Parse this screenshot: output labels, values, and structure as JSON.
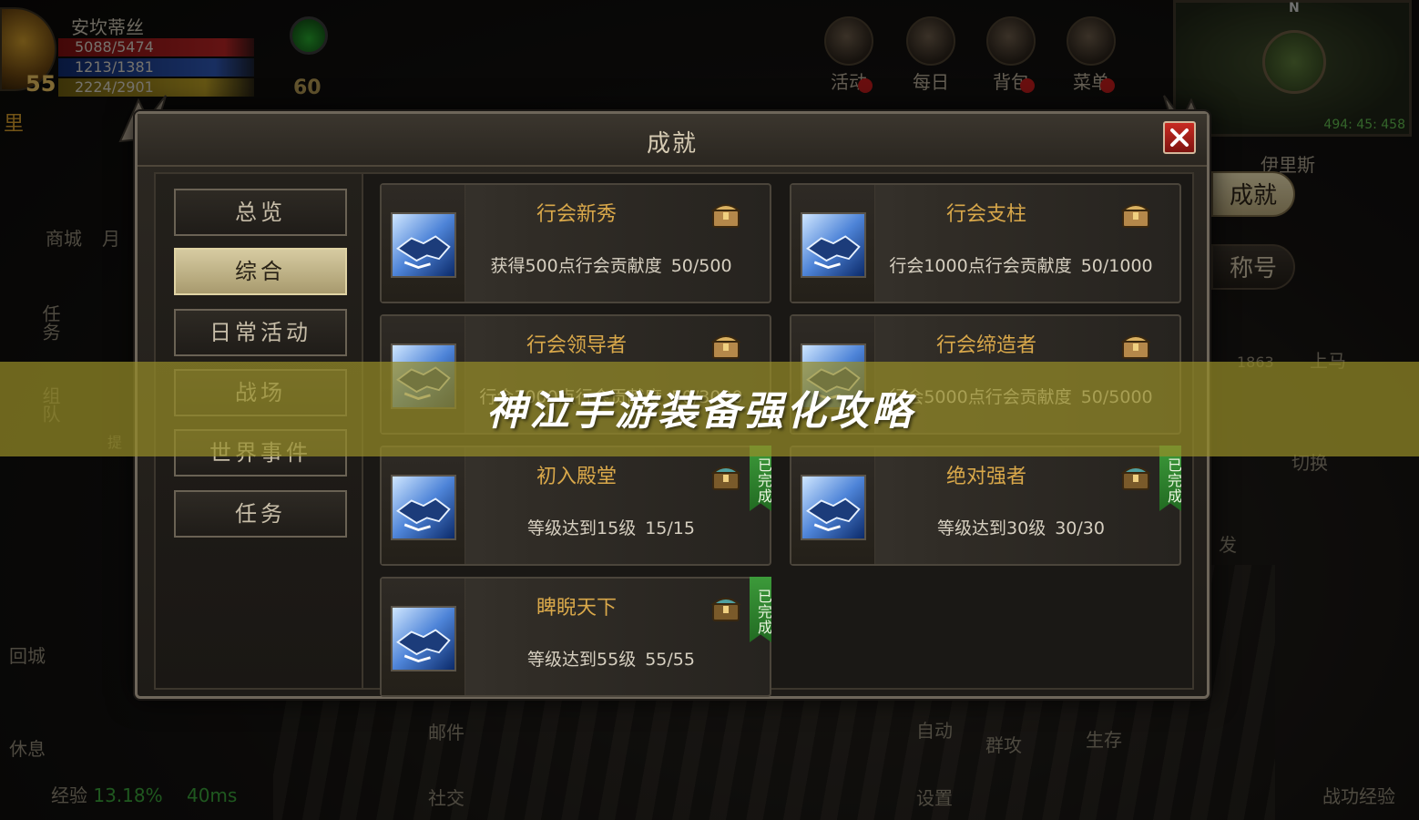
{
  "hud": {
    "player_name": "安坎蒂丝",
    "level": "55",
    "hp": "5088/5474",
    "mp": "1213/1381",
    "xp": "2224/2901",
    "power": "60",
    "map_label": "里",
    "top_icons": [
      {
        "label": "活动",
        "icon": "activity-icon"
      },
      {
        "label": "每日",
        "icon": "daily-icon"
      },
      {
        "label": "背包",
        "icon": "bag-icon"
      },
      {
        "label": "菜单",
        "icon": "menu-icon"
      }
    ],
    "minimap_north": "N",
    "coords": "494: 45: 458",
    "zone_name": "伊里斯",
    "side_tabs": {
      "active": "成就",
      "idle": "称号"
    },
    "left_buttons": [
      "商城",
      "月",
      "任务",
      "组队",
      "回城",
      "休息"
    ],
    "other_labels": [
      "上马",
      "切换",
      "邮件",
      "社交",
      "自动",
      "群攻",
      "生存",
      "设置",
      "战功经验",
      "发",
      "1863",
      "提"
    ],
    "exp_label": "经验",
    "exp_pct": "13.18%",
    "ping": "40ms"
  },
  "panel": {
    "title": "成就",
    "categories": [
      "总览",
      "综合",
      "日常活动",
      "战场",
      "世界事件",
      "任务"
    ],
    "active_category_index": 1,
    "cards": [
      {
        "title": "行会新秀",
        "desc": "获得500点行会贡献度",
        "progress": "50/500",
        "completed": false
      },
      {
        "title": "行会支柱",
        "desc": "行会1000点行会贡献度",
        "progress": "50/1000",
        "completed": false
      },
      {
        "title": "行会领导者",
        "desc": "行会3000点行会贡献度",
        "progress": "50/3000",
        "completed": false
      },
      {
        "title": "行会缔造者",
        "desc": "行会5000点行会贡献度",
        "progress": "50/5000",
        "completed": false
      },
      {
        "title": "初入殿堂",
        "desc": "等级达到15级",
        "progress": "15/15",
        "completed": true
      },
      {
        "title": "绝对强者",
        "desc": "等级达到30级",
        "progress": "30/30",
        "completed": true
      },
      {
        "title": "睥睨天下",
        "desc": "等级达到55级",
        "progress": "55/55",
        "completed": true
      }
    ],
    "done_label": "已完成"
  },
  "banner": {
    "text": "神泣手游装备强化攻略"
  },
  "colors": {
    "accent_gold": "#d9a84a",
    "banner_bg": "#968c28",
    "done_green": "#3c9a3a",
    "close_red": "#c82b22"
  }
}
